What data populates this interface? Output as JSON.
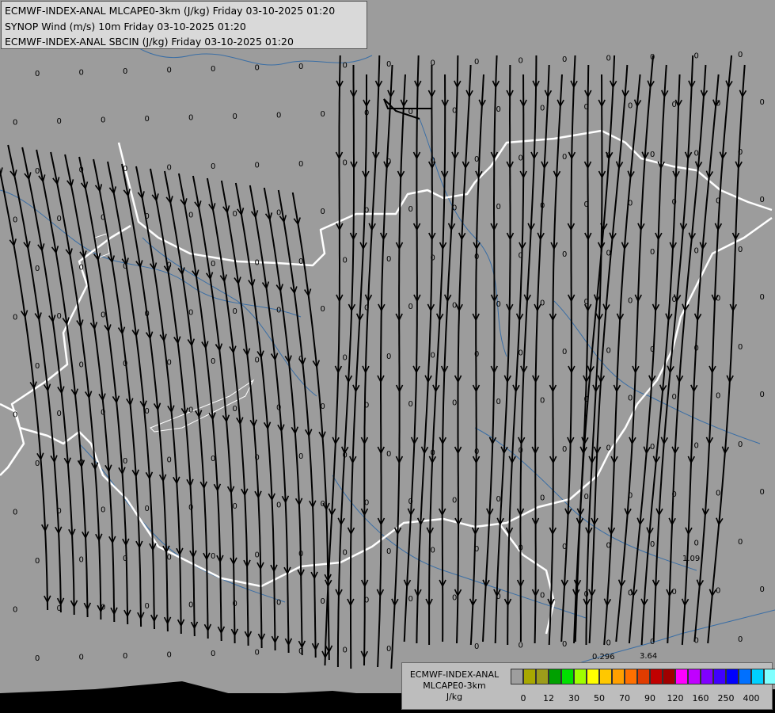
{
  "titles": [
    "ECMWF-INDEX-ANAL MLCAPE0-3km (J/kg) Friday 03-10-2025 01:20",
    "SYNOP Wind (m/s) 10m Friday 03-10-2025 01:20",
    "ECMWF-INDEX-ANAL SBCIN (J/kg) Friday 03-10-2025 01:20"
  ],
  "legend": {
    "line1": "ECMWF-INDEX-ANAL",
    "line2": "MLCAPE0-3km",
    "unit": "J/kg",
    "colors": [
      "#9e9e9e",
      "#a8a800",
      "#9c9c1a",
      "#00a000",
      "#00e000",
      "#a0ff00",
      "#ffff00",
      "#ffc800",
      "#ffa000",
      "#ff7000",
      "#e03c00",
      "#c00000",
      "#a00000",
      "#ff00ff",
      "#c000ff",
      "#8000ff",
      "#4000ff",
      "#0000ff",
      "#0070ff",
      "#00d0ff",
      "#80ffff",
      "#ffffff"
    ],
    "ticks": [
      "0",
      "12",
      "30",
      "50",
      "70",
      "90",
      "120",
      "160",
      "250",
      "400"
    ]
  },
  "annotations": {
    "a": "0.296",
    "b": "3.64",
    "c": "1.09"
  },
  "grid_value": "0",
  "map_colors": {
    "land": "#9c9c9c",
    "border": "#ffffff",
    "rivers": "#3a6ea5",
    "streamline": "#000000"
  }
}
